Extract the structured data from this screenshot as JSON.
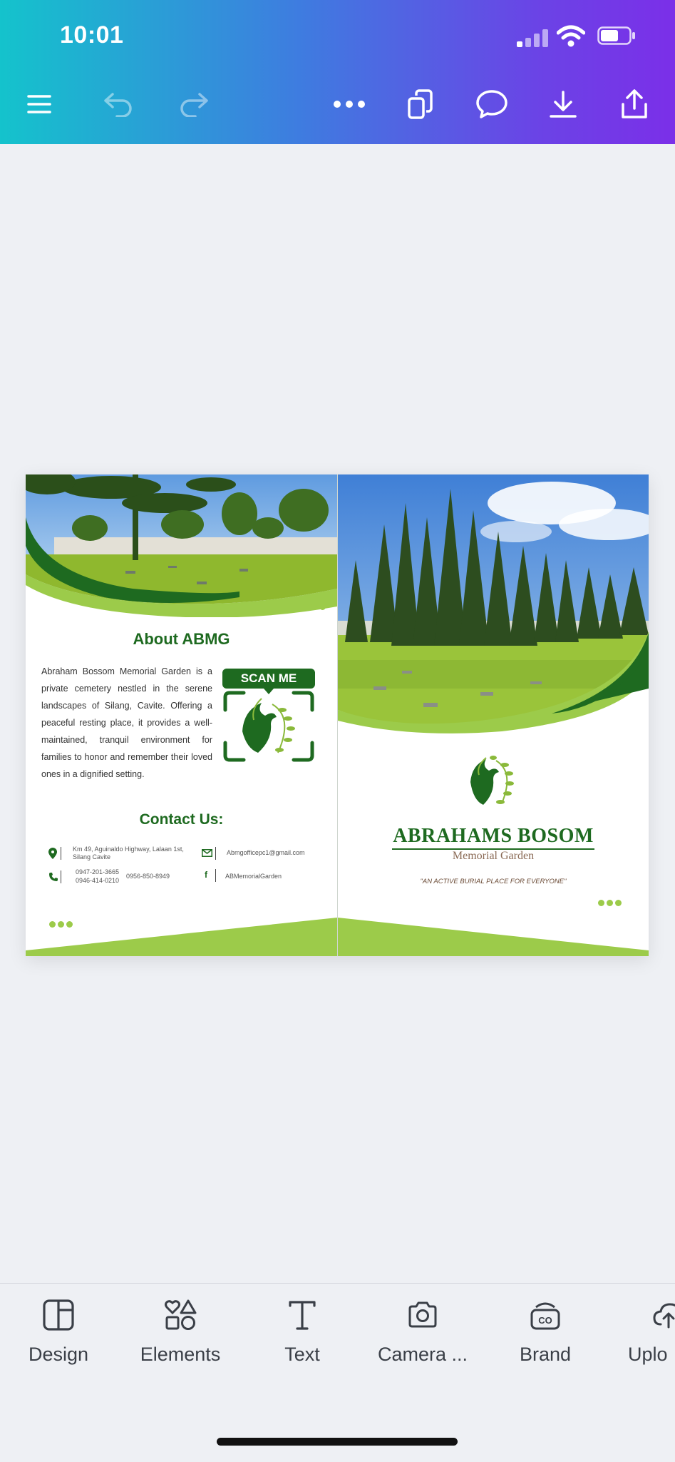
{
  "status_bar": {
    "time": "10:01"
  },
  "toolbar": {
    "icons": [
      "menu-icon",
      "undo-icon",
      "redo-icon",
      "more-icon",
      "pages-icon",
      "comment-icon",
      "download-icon",
      "share-icon"
    ]
  },
  "design": {
    "left_page": {
      "about_title": "About ABMG",
      "about_text": "Abraham Bossom Memorial Garden is a private cemetery nestled in the serene landscapes of Silang, Cavite. Offering a peaceful resting place, it provides a well-maintained, tranquil environment for families to honor and remember their loved ones in a dignified setting.",
      "scan_label": "SCAN ME",
      "contact_title": "Contact Us:",
      "address": "Km 49, Aguinaldo Highway, Lalaan 1st, Silang Cavite",
      "phone_1": "0947-201-3665",
      "phone_2": "0946-414-0210",
      "phone_3": "0956-850-8949",
      "email": "Abmgofficepc1@gmail.com",
      "facebook": "ABMemorialGarden"
    },
    "right_page": {
      "title": "ABRAHAMS  BOSOM",
      "subtitle": "Memorial Garden",
      "tagline": "\"AN ACTIVE BURIAL PLACE FOR EVERYONE\""
    },
    "colors": {
      "dark_green": "#1e6a20",
      "light_green": "#9ccb4a",
      "leaf_green": "#8ab93a"
    }
  },
  "bottom_tabs": [
    {
      "label": "Design",
      "icon": "design-layout-icon"
    },
    {
      "label": "Elements",
      "icon": "elements-shapes-icon"
    },
    {
      "label": "Text",
      "icon": "text-t-icon"
    },
    {
      "label": "Camera ...",
      "icon": "camera-icon"
    },
    {
      "label": "Brand",
      "icon": "brand-icon"
    },
    {
      "label": "Uplo",
      "icon": "upload-cloud-icon"
    }
  ]
}
